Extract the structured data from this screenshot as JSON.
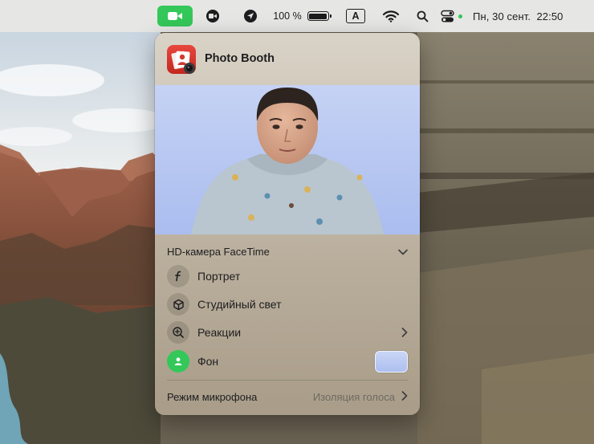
{
  "menubar": {
    "battery_percent": "100 %",
    "battery_level": 1.0,
    "input_source": "A",
    "datetime": "Пн, 30 сент.  22:50",
    "camera_active_color": "#34c759",
    "icons": [
      "video-camera-icon",
      "screen-recording-icon",
      "location-arrow-icon",
      "battery-icon",
      "input-source-icon",
      "wifi-icon",
      "spotlight-search-icon",
      "control-center-icon"
    ]
  },
  "popover": {
    "app_name": "Photo Booth",
    "camera_name": "HD-камера FaceTime",
    "effects": [
      {
        "label": "Портрет",
        "icon": "portrait-f-icon",
        "active": false
      },
      {
        "label": "Студийный свет",
        "icon": "cube-icon",
        "active": false
      },
      {
        "label": "Реакции",
        "icon": "reactions-plus-icon",
        "active": false,
        "has_chevron": true
      },
      {
        "label": "Фон",
        "icon": "person-background-icon",
        "active": true
      }
    ],
    "mic_mode_label": "Режим микрофона",
    "mic_mode_value": "Изоляция голоса"
  }
}
